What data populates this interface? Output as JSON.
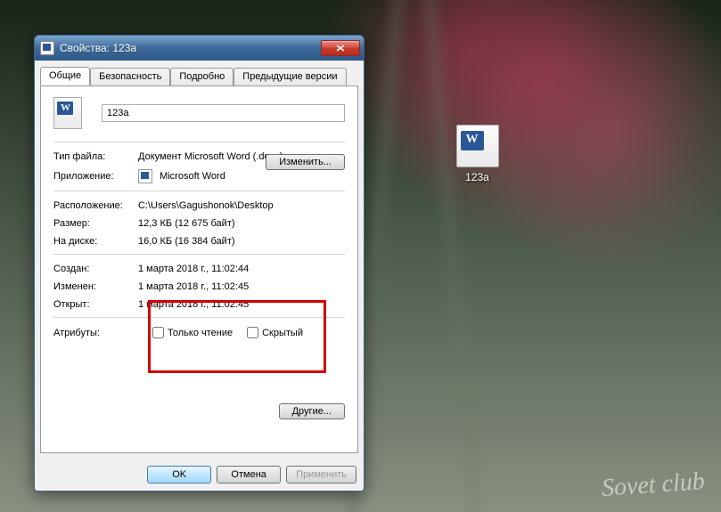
{
  "desktop": {
    "file_label": "123а",
    "watermark": "Sovet club"
  },
  "dialog": {
    "title": "Свойства: 123а",
    "tabs": {
      "general": "Общие",
      "security": "Безопасность",
      "details": "Подробно",
      "previous": "Предыдущие версии"
    },
    "filename": "123а",
    "fields": {
      "filetype_label": "Тип файла:",
      "filetype_value": "Документ Microsoft Word (.docx)",
      "app_label": "Приложение:",
      "app_value": "Microsoft Word",
      "change_btn": "Изменить...",
      "location_label": "Расположение:",
      "location_value": "C:\\Users\\Gagushonok\\Desktop",
      "size_label": "Размер:",
      "size_value": "12,3 КБ (12 675 байт)",
      "disk_label": "На диске:",
      "disk_value": "16,0 КБ (16 384 байт)",
      "created_label": "Создан:",
      "created_value": "1 марта 2018 г., 11:02:44",
      "modified_label": "Изменен:",
      "modified_value": "1 марта 2018 г., 11:02:45",
      "accessed_label": "Открыт:",
      "accessed_value": "1 марта 2018 г., 11:02:45",
      "attributes_label": "Атрибуты:",
      "readonly": "Только чтение",
      "hidden": "Скрытый",
      "other_btn": "Другие..."
    },
    "buttons": {
      "ok": "OK",
      "cancel": "Отмена",
      "apply": "Применить"
    }
  }
}
